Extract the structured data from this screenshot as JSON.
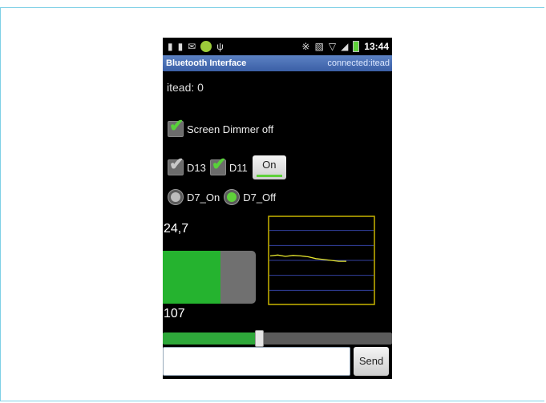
{
  "status_bar": {
    "time": "13:44",
    "icons": [
      "usb-icon",
      "usb-icon",
      "mail-icon",
      "android-icon",
      "usb-debug-icon",
      "bluetooth-icon",
      "vibrate-icon",
      "wifi-icon",
      "signal-icon",
      "battery-icon"
    ]
  },
  "title_bar": {
    "app_name": "Bluetooth Interface",
    "connection_status": "connected:itead"
  },
  "device_line": "itead: 0",
  "screen_dimmer": {
    "label": "Screen Dimmer off",
    "checked": true
  },
  "pins": [
    {
      "label": "D13",
      "checked": true,
      "enabled": false
    },
    {
      "label": "D11",
      "checked": true,
      "enabled": true
    }
  ],
  "toggle_button": {
    "label": "On",
    "state": true
  },
  "radios": [
    {
      "label": "D7_On",
      "selected": false
    },
    {
      "label": "D7_Off",
      "selected": true
    }
  ],
  "sensor_value": "24,7",
  "gauge": {
    "fraction": 0.62,
    "fill_color": "#25b32f",
    "track_color": "#707070"
  },
  "gauge_value": "107",
  "graph": {
    "border_color": "#c8b400",
    "line_color": "#e6e62e",
    "grid_color": "#3340a0",
    "levels": [
      0.55,
      0.56,
      0.545,
      0.555,
      0.55,
      0.54,
      0.52,
      0.51,
      0.5,
      0.49,
      0.49
    ]
  },
  "slider": {
    "fraction": 0.42
  },
  "message_input": {
    "value": "",
    "placeholder": ""
  },
  "send_button": {
    "label": "Send"
  }
}
